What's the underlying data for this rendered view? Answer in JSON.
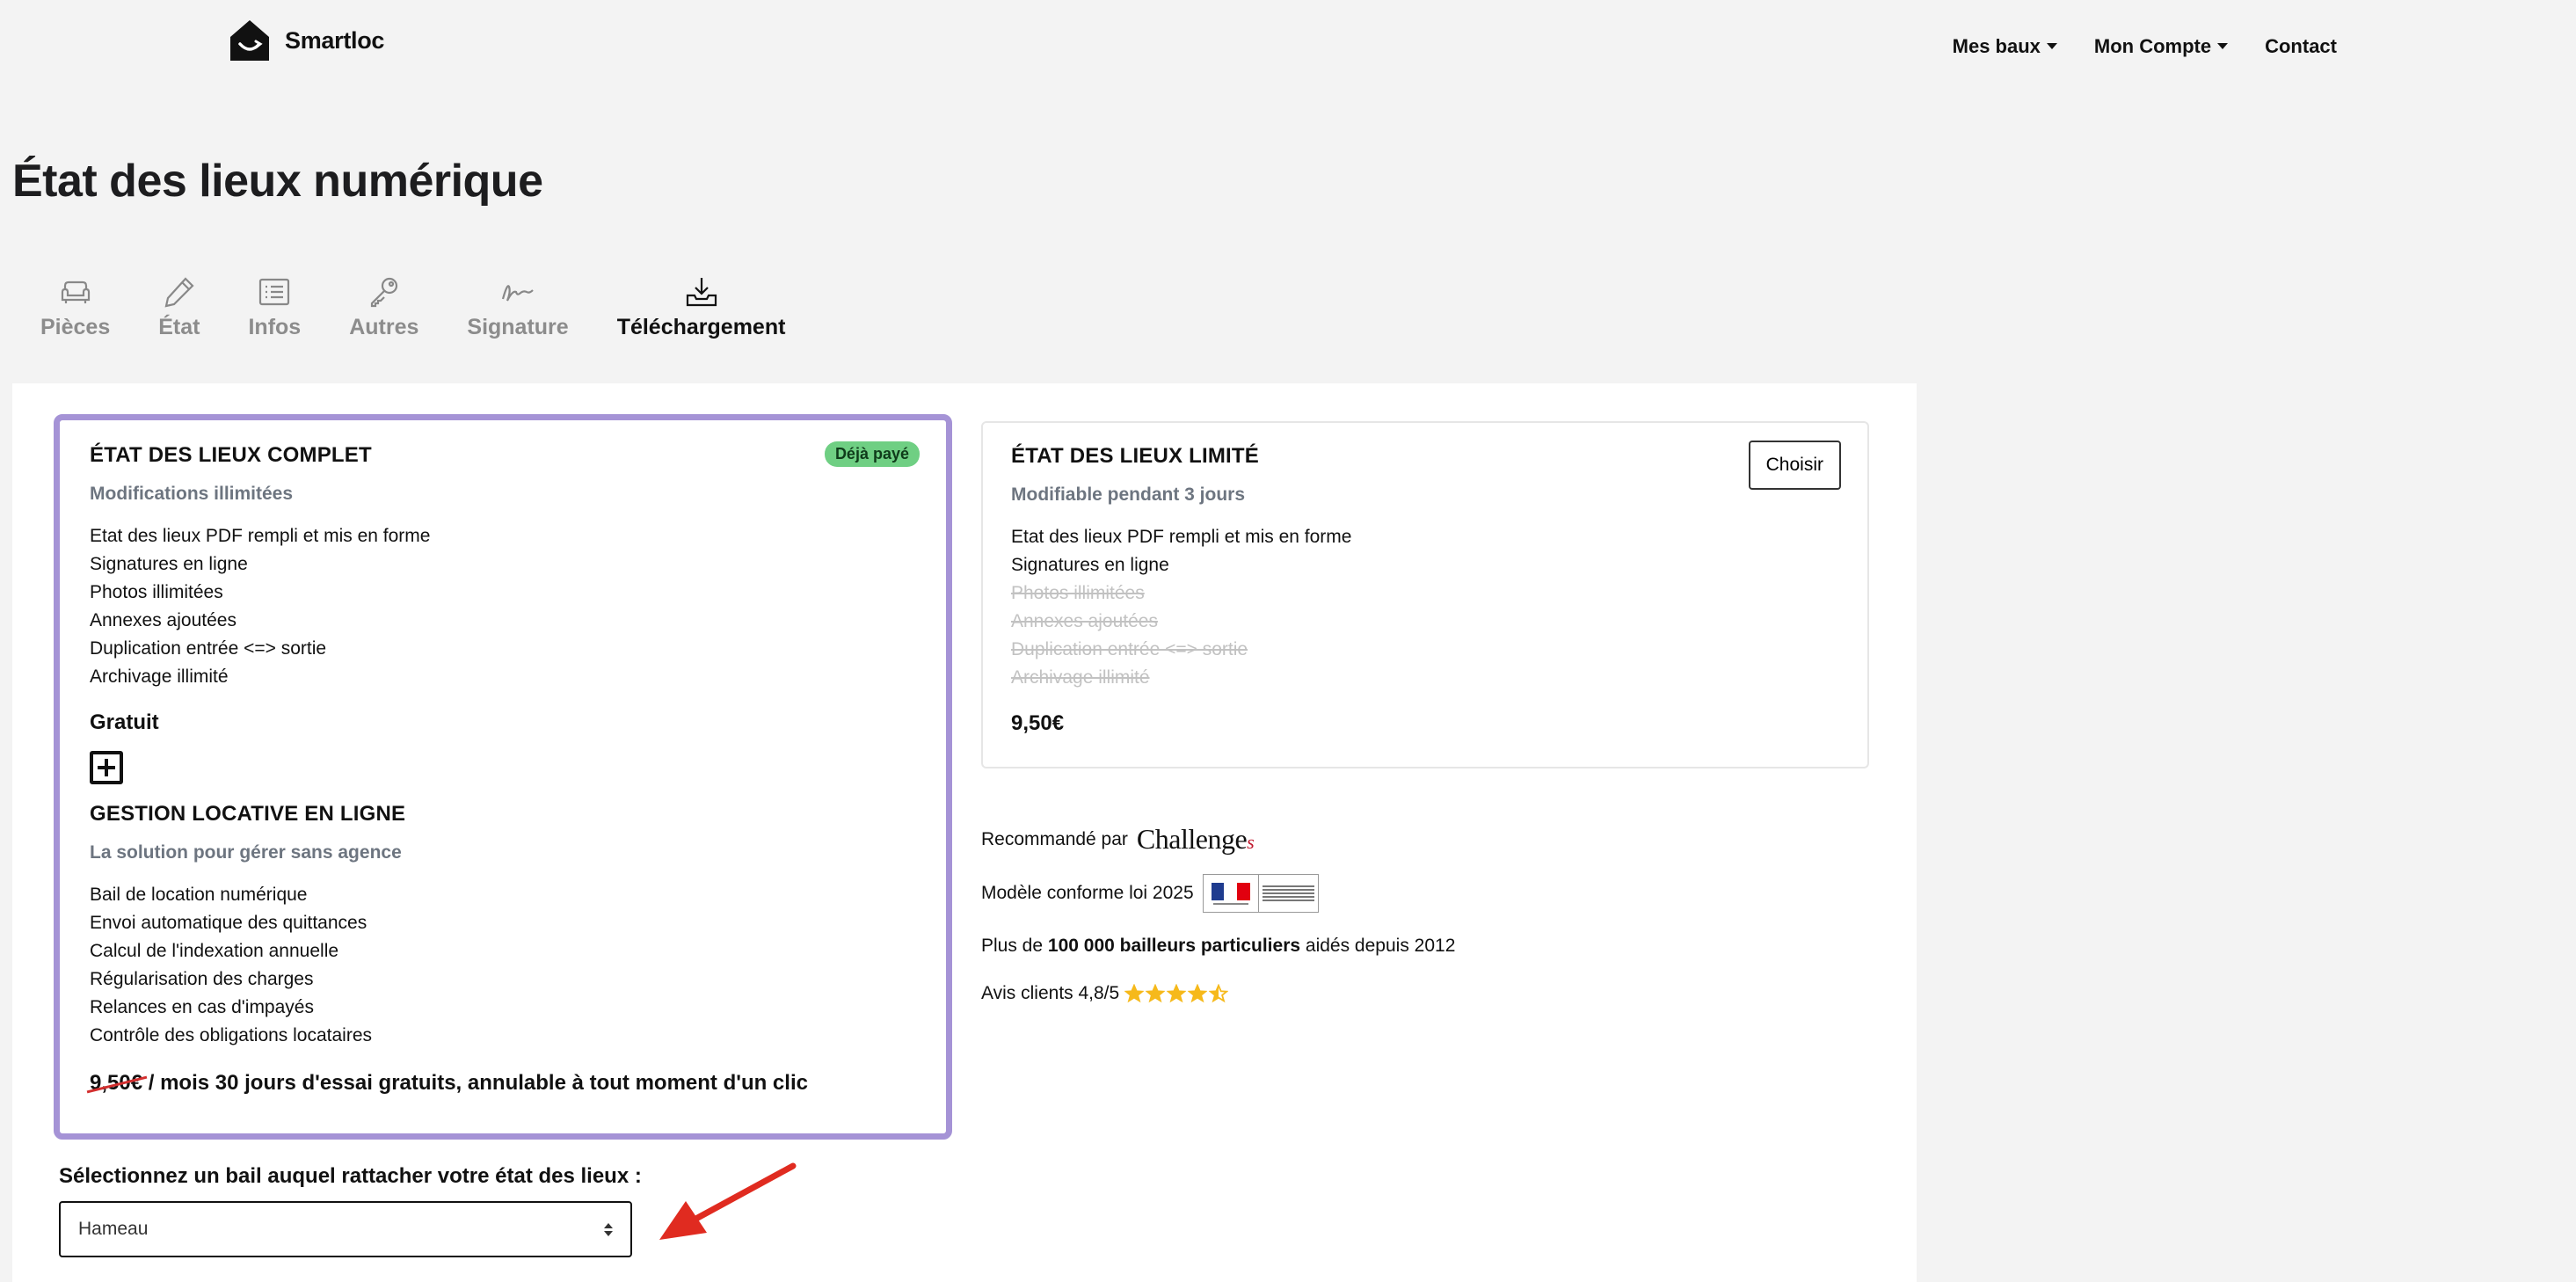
{
  "brand": {
    "name": "Smartloc"
  },
  "nav": {
    "items": [
      {
        "label": "Mes baux",
        "dropdown": true
      },
      {
        "label": "Mon Compte",
        "dropdown": true
      },
      {
        "label": "Contact",
        "dropdown": false
      }
    ]
  },
  "page": {
    "title": "État des lieux numérique"
  },
  "tabs": [
    {
      "label": "Pièces",
      "icon": "sofa-icon",
      "active": false
    },
    {
      "label": "État",
      "icon": "pencil-icon",
      "active": false
    },
    {
      "label": "Infos",
      "icon": "list-icon",
      "active": false
    },
    {
      "label": "Autres",
      "icon": "key-icon",
      "active": false
    },
    {
      "label": "Signature",
      "icon": "signature-icon",
      "active": false
    },
    {
      "label": "Téléchargement",
      "icon": "download-icon",
      "active": true
    }
  ],
  "offer_full": {
    "title": "ÉTAT DES LIEUX COMPLET",
    "badge": "Déjà payé",
    "subtitle": "Modifications illimitées",
    "features": [
      "Etat des lieux PDF rempli et mis en forme",
      "Signatures en ligne",
      "Photos illimitées",
      "Annexes ajoutées",
      "Duplication entrée <=> sortie",
      "Archivage illimité"
    ],
    "price": "Gratuit",
    "addon": {
      "title": "GESTION LOCATIVE EN LIGNE",
      "subtitle": "La solution pour gérer sans agence",
      "features": [
        "Bail de location numérique",
        "Envoi automatique des quittances",
        "Calcul de l'indexation annuelle",
        "Régularisation des charges",
        "Relances en cas d'impayés",
        "Contrôle des obligations locataires"
      ],
      "old_price": "9,50€",
      "promo_text": " / mois 30 jours d'essai gratuits, annulable à tout moment d'un clic"
    }
  },
  "offer_limited": {
    "title": "ÉTAT DES LIEUX LIMITÉ",
    "button": "Choisir",
    "subtitle": "Modifiable pendant 3 jours",
    "features": [
      {
        "label": "Etat des lieux PDF rempli et mis en forme",
        "included": true
      },
      {
        "label": "Signatures en ligne",
        "included": true
      },
      {
        "label": "Photos illimitées",
        "included": false
      },
      {
        "label": "Annexes ajoutées",
        "included": false
      },
      {
        "label": "Duplication entrée <=> sortie",
        "included": false
      },
      {
        "label": "Archivage illimité",
        "included": false
      }
    ],
    "price": "9,50€"
  },
  "trust": {
    "recommended_label": "Recommandé par",
    "recommended_brand": "Challenge",
    "recommended_brand_suffix": "s",
    "compliance": "Modèle conforme loi 2025",
    "users_prefix": "Plus de ",
    "users_bold": "100 000 bailleurs particuliers",
    "users_suffix": " aidés depuis 2012",
    "reviews": "Avis clients 4,8/5",
    "rating": 4.5,
    "star_color": "#f6b91b"
  },
  "bail_select": {
    "label": "Sélectionnez un bail auquel rattacher votre état des lieux :",
    "value": "Hameau"
  },
  "colors": {
    "accent_border": "#a593d6",
    "badge_green": "#6fcf83",
    "arrow_red": "#e02b20"
  }
}
